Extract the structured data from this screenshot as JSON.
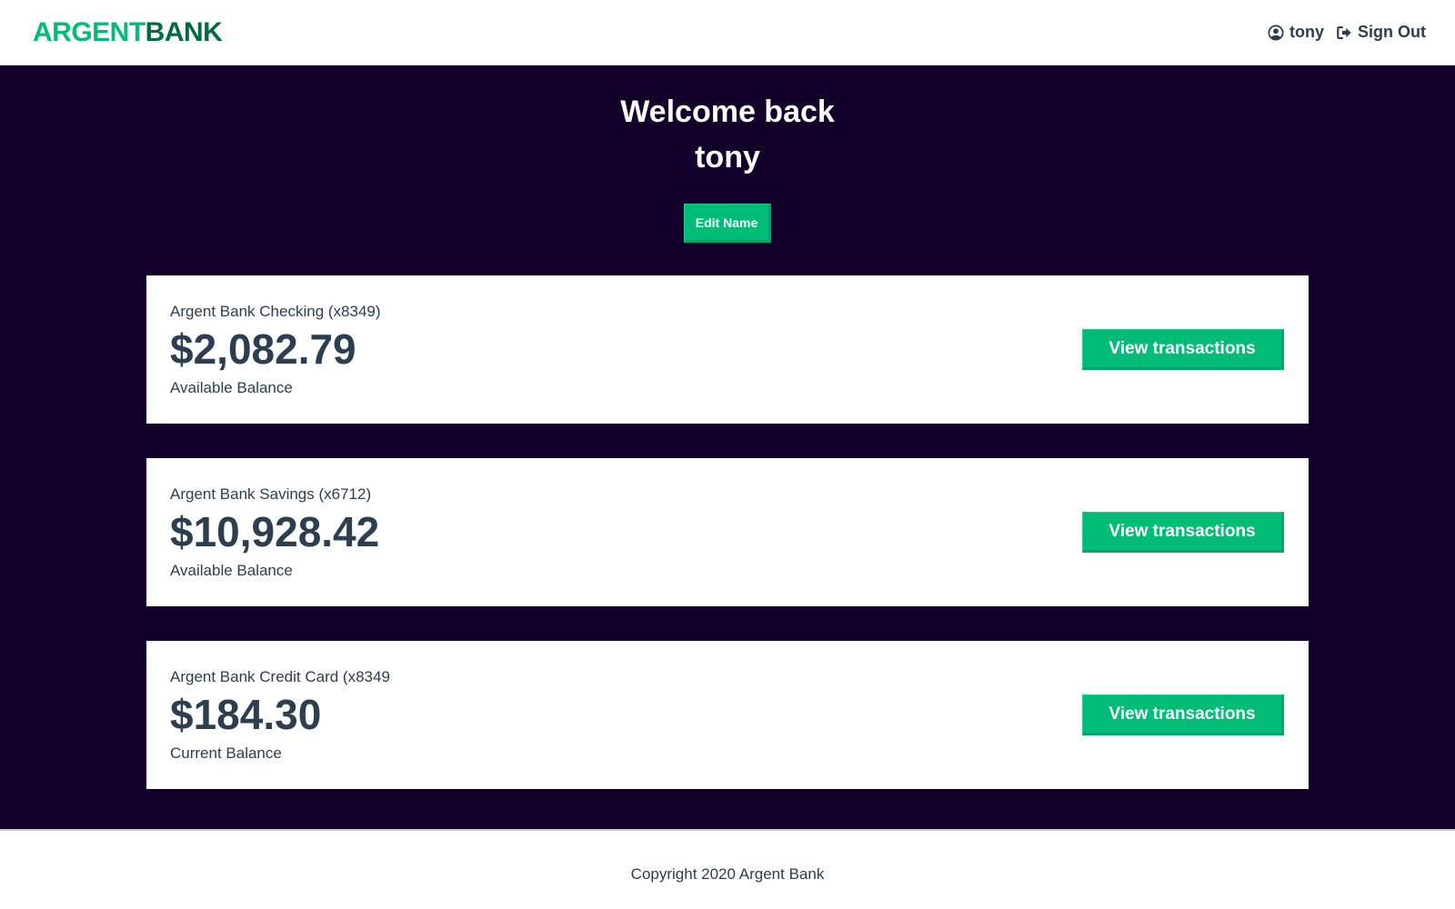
{
  "nav": {
    "logo_part1": "ARGENT",
    "logo_part2": "BANK",
    "user_label": "tony",
    "user_icon": "user-circle-icon",
    "signout_label": "Sign Out",
    "signout_icon": "sign-out-icon"
  },
  "header": {
    "welcome": "Welcome back",
    "name": "tony",
    "edit_label": "Edit Name"
  },
  "accounts": [
    {
      "title": "Argent Bank Checking (x8349)",
      "amount": "$2,082.79",
      "description": "Available Balance",
      "button": "View transactions"
    },
    {
      "title": "Argent Bank Savings (x6712)",
      "amount": "$10,928.42",
      "description": "Available Balance",
      "button": "View transactions"
    },
    {
      "title": "Argent Bank Credit Card (x8349",
      "amount": "$184.30",
      "description": "Current Balance",
      "button": "View transactions"
    }
  ],
  "footer": {
    "copyright": "Copyright 2020 Argent Bank"
  },
  "colors": {
    "brand_green": "#00bc77",
    "brand_dark_green": "#006b43",
    "background_dark": "#12002b",
    "text": "#2c3e50"
  }
}
